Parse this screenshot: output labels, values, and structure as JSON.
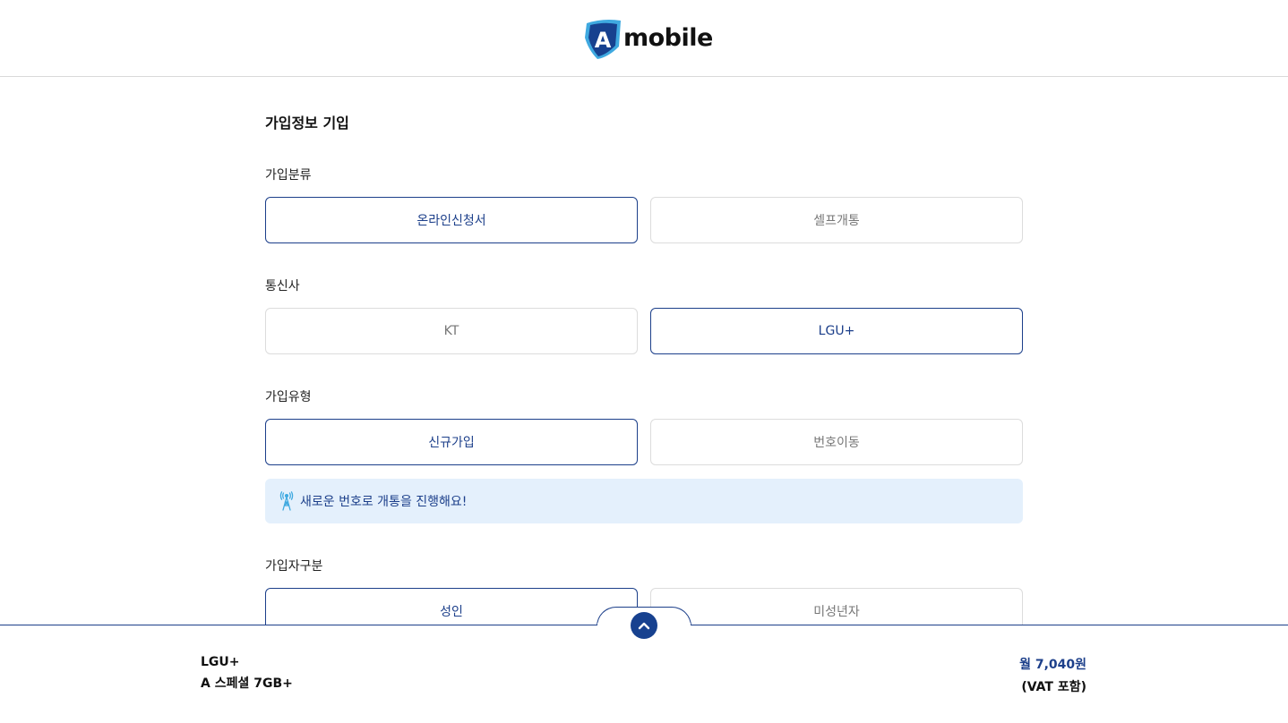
{
  "header": {
    "logo_text": "mobile",
    "logo_mark_letter": "A",
    "brand_colors": {
      "dark_blue": "#17418f",
      "light_blue": "#3fa9e0"
    }
  },
  "form": {
    "title": "가입정보 기입",
    "groups": {
      "signup_category": {
        "label": "가입분류",
        "options": [
          "온라인신청서",
          "셀프개통"
        ],
        "selected": "온라인신청서"
      },
      "carrier": {
        "label": "통신사",
        "options": [
          "KT",
          "LGU+"
        ],
        "selected": "LGU+"
      },
      "signup_type": {
        "label": "가입유형",
        "options": [
          "신규가입",
          "번호이동"
        ],
        "selected": "신규가입"
      },
      "subscriber_type": {
        "label": "가입자구분",
        "options": [
          "성인",
          "미성년자"
        ],
        "selected": "성인"
      }
    },
    "notice": {
      "icon": "antenna-tower-icon",
      "text": "새로운 번호로 개통을 진행해요!"
    }
  },
  "summary": {
    "carrier": "LGU+",
    "plan": "A 스페셜 7GB+",
    "price": "월 7,040원",
    "vat": "(VAT 포함)",
    "toggle_icon": "chevron-up-icon"
  },
  "colors": {
    "accent": "#1c3f8a",
    "notice_bg": "#e4f0fc",
    "border": "#dcdcdc"
  }
}
